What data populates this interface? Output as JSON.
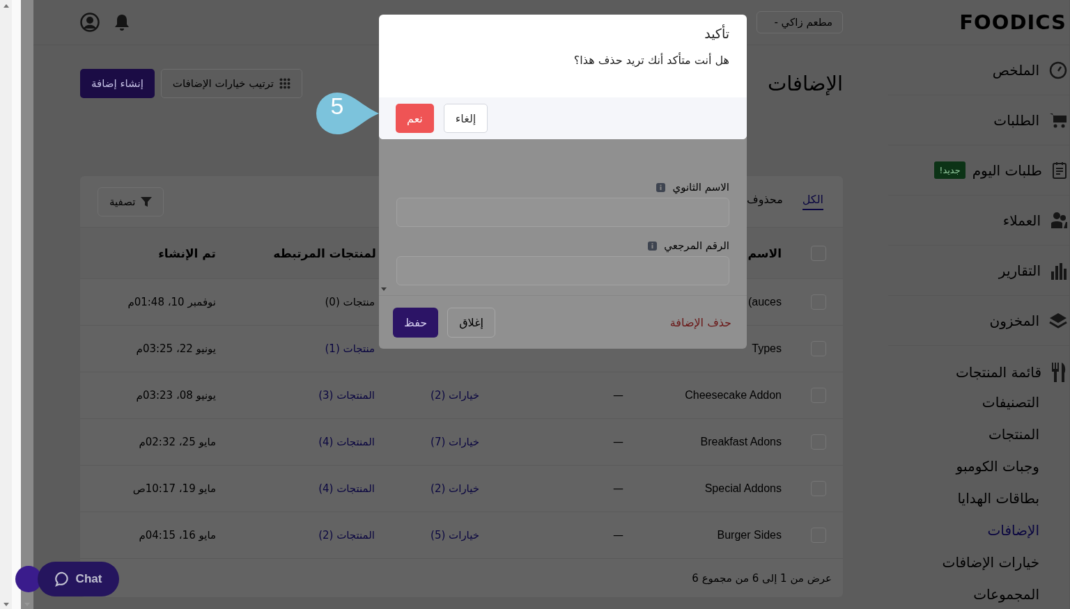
{
  "logo": {
    "text": "FOODICS"
  },
  "header": {
    "search": {
      "value": "مطعم زاكي -"
    }
  },
  "sidebar": {
    "items": [
      {
        "label": "الملخص",
        "selected": false
      },
      {
        "label": "الطلبات",
        "selected": false
      },
      {
        "label": "طلبات اليوم",
        "selected": false,
        "badge": "جديد!"
      },
      {
        "label": "العملاء",
        "selected": false
      },
      {
        "label": "التقارير",
        "selected": false
      },
      {
        "label": "المخزون",
        "selected": false
      }
    ],
    "menu_group": {
      "label": "قائمة المنتجات",
      "children": [
        {
          "label": "التصنيفات",
          "selected": false
        },
        {
          "label": "المنتجات",
          "selected": false
        },
        {
          "label": "وجبات الكومبو",
          "selected": false
        },
        {
          "label": "بطاقات الهدايا",
          "selected": false
        },
        {
          "label": "الإضافات",
          "selected": true
        },
        {
          "label": "خيارات الإضافات",
          "selected": false
        },
        {
          "label": "المجموعات",
          "selected": false
        }
      ]
    }
  },
  "page": {
    "title": "الإضافات",
    "buttons": [
      {
        "label": "ترتيب خيارات الإضافات",
        "kind": "secondary"
      },
      {
        "label": "إنشاء إضافة",
        "kind": "primary"
      }
    ]
  },
  "card": {
    "tabs": [
      {
        "label": "الكل",
        "selected": true
      },
      {
        "label": "محذوف",
        "selected": false
      }
    ],
    "filter": "تصفية",
    "select_all_checked": false,
    "columns": [
      {
        "label": "الاسم"
      },
      {
        "label": "لمنتجات المرتبطه"
      },
      {
        "label": "تم الإنشاء"
      }
    ],
    "rows": [
      {
        "checked": false,
        "name": "auces)",
        "products": "منتجات (0)",
        "products_link": false,
        "created": "نوفمبر 10، 01:48م"
      },
      {
        "checked": false,
        "name": "Types",
        "products": "منتجات (1)",
        "products_link": true,
        "created": "يونيو 22، 03:25م"
      },
      {
        "checked": false,
        "name": "Cheesecake Addon",
        "description": "—",
        "options": "خيارات (2)",
        "products": "المنتجات (3)",
        "products_link": true,
        "created": "يونيو 08، 03:23م"
      },
      {
        "checked": false,
        "name": "Breakfast Adons",
        "description": "—",
        "options": "خيارات (7)",
        "products": "المنتجات (4)",
        "products_link": true,
        "created": "مايو 25، 02:32م"
      },
      {
        "checked": false,
        "name": "Special Addons",
        "description": "—",
        "options": "خيارات (2)",
        "products": "المنتجات (4)",
        "products_link": true,
        "created": "مايو 19، 10:17ص"
      },
      {
        "checked": false,
        "name": "Burger Sides",
        "description": "—",
        "options": "خيارات (5)",
        "products": "المنتجات (2)",
        "products_link": true,
        "created": "مايو 16، 04:15م"
      }
    ],
    "footer": "عرض من 1 إلى 6 من مجموع 6"
  },
  "chat": {
    "label": "Chat"
  },
  "form_modal": {
    "fields": [
      {
        "label": "الاسم الثانوي"
      },
      {
        "label": "الرقم المرجعي"
      }
    ],
    "buttons": [
      {
        "label": "حذف الإضافة",
        "kind": "delete"
      },
      {
        "label": "إغلاق",
        "kind": "close"
      },
      {
        "label": "حفظ",
        "kind": "save"
      }
    ]
  },
  "confirm_dialog": {
    "title": "تأكيد",
    "message": "هل أنت متأكد أنك تريد حذف هذا؟",
    "buttons": [
      {
        "label": "إلغاء",
        "kind": "cancel"
      },
      {
        "label": "نعم",
        "kind": "danger"
      }
    ]
  },
  "step_marker": {
    "label": "5"
  }
}
